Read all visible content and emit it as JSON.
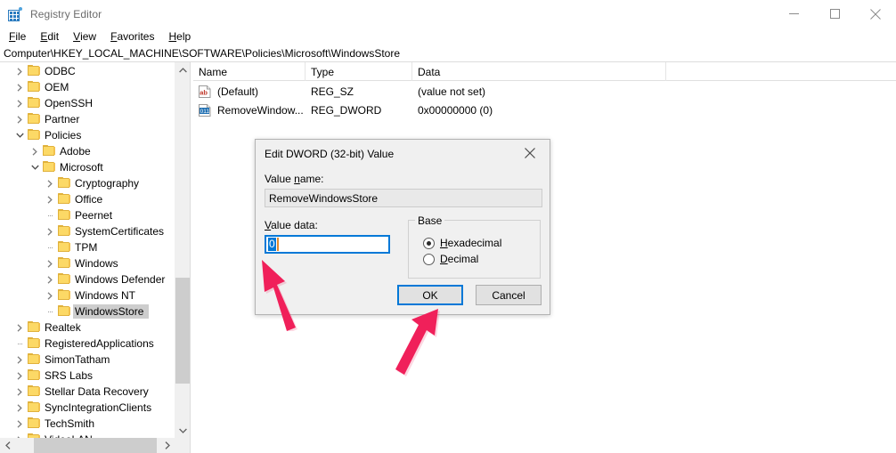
{
  "window": {
    "title": "Registry Editor",
    "app_icon": "registry-editor-icon",
    "controls": {
      "minimize": "minimize",
      "maximize": "maximize",
      "close": "close"
    }
  },
  "menubar": {
    "items": [
      {
        "label": "File",
        "accel": "F"
      },
      {
        "label": "Edit",
        "accel": "E"
      },
      {
        "label": "View",
        "accel": "V"
      },
      {
        "label": "Favorites",
        "accel": "F"
      },
      {
        "label": "Help",
        "accel": "H"
      }
    ]
  },
  "address": {
    "path": "Computer\\HKEY_LOCAL_MACHINE\\SOFTWARE\\Policies\\Microsoft\\WindowsStore"
  },
  "tree": {
    "items": [
      {
        "label": "ODBC",
        "indent": 1,
        "state": "collapsed",
        "selected": false
      },
      {
        "label": "OEM",
        "indent": 1,
        "state": "collapsed",
        "selected": false
      },
      {
        "label": "OpenSSH",
        "indent": 1,
        "state": "collapsed",
        "selected": false
      },
      {
        "label": "Partner",
        "indent": 1,
        "state": "collapsed",
        "selected": false
      },
      {
        "label": "Policies",
        "indent": 1,
        "state": "expanded",
        "selected": false
      },
      {
        "label": "Adobe",
        "indent": 2,
        "state": "collapsed",
        "selected": false
      },
      {
        "label": "Microsoft",
        "indent": 2,
        "state": "expanded",
        "selected": false
      },
      {
        "label": "Cryptography",
        "indent": 3,
        "state": "collapsed",
        "selected": false
      },
      {
        "label": "Office",
        "indent": 3,
        "state": "collapsed",
        "selected": false
      },
      {
        "label": "Peernet",
        "indent": 3,
        "state": "leaf",
        "selected": false
      },
      {
        "label": "SystemCertificates",
        "indent": 3,
        "state": "collapsed",
        "selected": false
      },
      {
        "label": "TPM",
        "indent": 3,
        "state": "leaf",
        "selected": false
      },
      {
        "label": "Windows",
        "indent": 3,
        "state": "collapsed",
        "selected": false
      },
      {
        "label": "Windows Defender",
        "indent": 3,
        "state": "collapsed",
        "selected": false
      },
      {
        "label": "Windows NT",
        "indent": 3,
        "state": "collapsed",
        "selected": false
      },
      {
        "label": "WindowsStore",
        "indent": 3,
        "state": "leaf",
        "selected": true
      },
      {
        "label": "Realtek",
        "indent": 1,
        "state": "collapsed",
        "selected": false
      },
      {
        "label": "RegisteredApplications",
        "indent": 1,
        "state": "leaf",
        "selected": false
      },
      {
        "label": "SimonTatham",
        "indent": 1,
        "state": "collapsed",
        "selected": false
      },
      {
        "label": "SRS Labs",
        "indent": 1,
        "state": "collapsed",
        "selected": false
      },
      {
        "label": "Stellar Data Recovery",
        "indent": 1,
        "state": "collapsed",
        "selected": false
      },
      {
        "label": "SyncIntegrationClients",
        "indent": 1,
        "state": "collapsed",
        "selected": false
      },
      {
        "label": "TechSmith",
        "indent": 1,
        "state": "collapsed",
        "selected": false
      },
      {
        "label": "VideoLAN",
        "indent": 1,
        "state": "collapsed",
        "selected": false
      }
    ]
  },
  "values": {
    "columns": [
      "Name",
      "Type",
      "Data"
    ],
    "rows": [
      {
        "icon": "string-value-icon",
        "name": "(Default)",
        "type": "REG_SZ",
        "data": "(value not set)"
      },
      {
        "icon": "dword-value-icon",
        "name": "RemoveWindow...",
        "type": "REG_DWORD",
        "data": "0x00000000 (0)"
      }
    ]
  },
  "dialog": {
    "title": "Edit DWORD (32-bit) Value",
    "close_label": "Close",
    "value_name_label": "Value name:",
    "value_name": "RemoveWindowsStore",
    "value_data_label": "Value data:",
    "value_data": "0",
    "base": {
      "legend": "Base",
      "options": [
        {
          "label": "Hexadecimal",
          "selected": true
        },
        {
          "label": "Decimal",
          "selected": false
        }
      ]
    },
    "ok_label": "OK",
    "cancel_label": "Cancel"
  },
  "annotations": {
    "arrow_color": "#f0205a",
    "arrows": [
      {
        "name": "arrow-to-value-data",
        "direction": "up-left"
      },
      {
        "name": "arrow-to-ok-button",
        "direction": "up-right"
      }
    ]
  },
  "colors": {
    "accent": "#0078d7",
    "folder": "#fcd966",
    "selection_gray": "#cdcdcd",
    "chrome": "#f0f0f0"
  }
}
